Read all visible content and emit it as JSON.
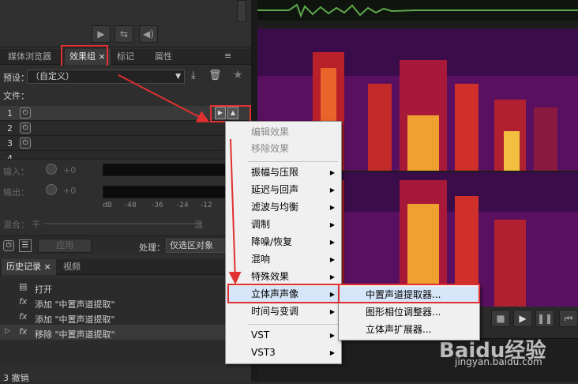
{
  "tabs": [
    "媒体浏览器",
    "效果组 ×",
    "标记",
    "属性"
  ],
  "tab_menu_icon": "≡",
  "preset": {
    "label": "预设：",
    "value": "（自定义）"
  },
  "file_label": "文件：",
  "slots": [
    "1",
    "2",
    "3",
    "4"
  ],
  "input_label": "输入：",
  "input_value": "+0",
  "output_label": "输出：",
  "output_value": "+0",
  "db_scale": [
    "dB",
    "-48",
    "-36",
    "-24",
    "-12"
  ],
  "mix": {
    "label": "混合：",
    "dry": "干",
    "wet": "湿"
  },
  "apply_label": "应用",
  "process": {
    "label": "处理：",
    "value": "仅选区对象"
  },
  "history_tabs": [
    "历史记录 ×",
    "视频"
  ],
  "history": [
    {
      "icon": "doc-icon",
      "text": "打开"
    },
    {
      "icon": "fx",
      "text": "添加 \"中置声道提取\""
    },
    {
      "icon": "fx",
      "text": "添加 \"中置声道提取\""
    },
    {
      "icon": "fx",
      "text": "移除 \"中置声道提取\""
    }
  ],
  "undo_status": "3 撤销",
  "menu": {
    "items": [
      {
        "label": "编辑效果",
        "disabled": true
      },
      {
        "label": "移除效果",
        "disabled": true
      },
      {
        "label": "振幅与压限",
        "sub": true
      },
      {
        "label": "延迟与回声",
        "sub": true
      },
      {
        "label": "滤波与均衡",
        "sub": true
      },
      {
        "label": "调制",
        "sub": true
      },
      {
        "label": "降噪/恢复",
        "sub": true
      },
      {
        "label": "混响",
        "sub": true
      },
      {
        "label": "特殊效果",
        "sub": true
      },
      {
        "label": "立体声声像",
        "sub": true
      },
      {
        "label": "时间与变调",
        "sub": true
      },
      {
        "label": "VST",
        "sub": true
      },
      {
        "label": "VST3",
        "sub": true
      }
    ]
  },
  "submenu": [
    "中置声道提取器...",
    "图形相位调整器...",
    "立体声扩展器..."
  ],
  "watermark": {
    "logo": "Baidu经验",
    "url": "jingyan.baidu.com"
  },
  "colors": {
    "highlight": "#e03030",
    "accent": "#e8b400"
  }
}
